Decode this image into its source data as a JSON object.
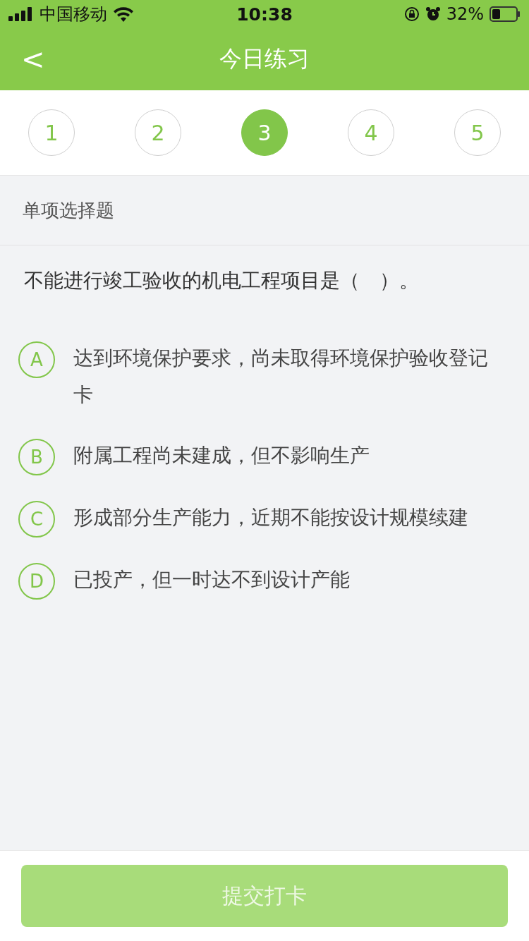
{
  "status_bar": {
    "carrier": "中国移动",
    "time": "10:38",
    "battery": "32%"
  },
  "nav": {
    "back": "<",
    "title": "今日练习"
  },
  "question_tabs": [
    {
      "label": "1",
      "selected": false
    },
    {
      "label": "2",
      "selected": false
    },
    {
      "label": "3",
      "selected": true
    },
    {
      "label": "4",
      "selected": false
    },
    {
      "label": "5",
      "selected": false
    }
  ],
  "question_type": "单项选择题",
  "question": "不能进行竣工验收的机电工程项目是（　）。",
  "options": [
    {
      "letter": "A",
      "text": "达到环境保护要求，尚未取得环境保护验收登记卡",
      "selected": false
    },
    {
      "letter": "B",
      "text": "附属工程尚未建成，但不影响生产",
      "selected": false
    },
    {
      "letter": "C",
      "text": "形成部分生产能力，近期不能按设计规模续建",
      "selected": false
    },
    {
      "letter": "D",
      "text": "已投产，但一时达不到设计产能",
      "selected": false
    }
  ],
  "submit": {
    "label": "提交打卡",
    "disabled": true
  }
}
